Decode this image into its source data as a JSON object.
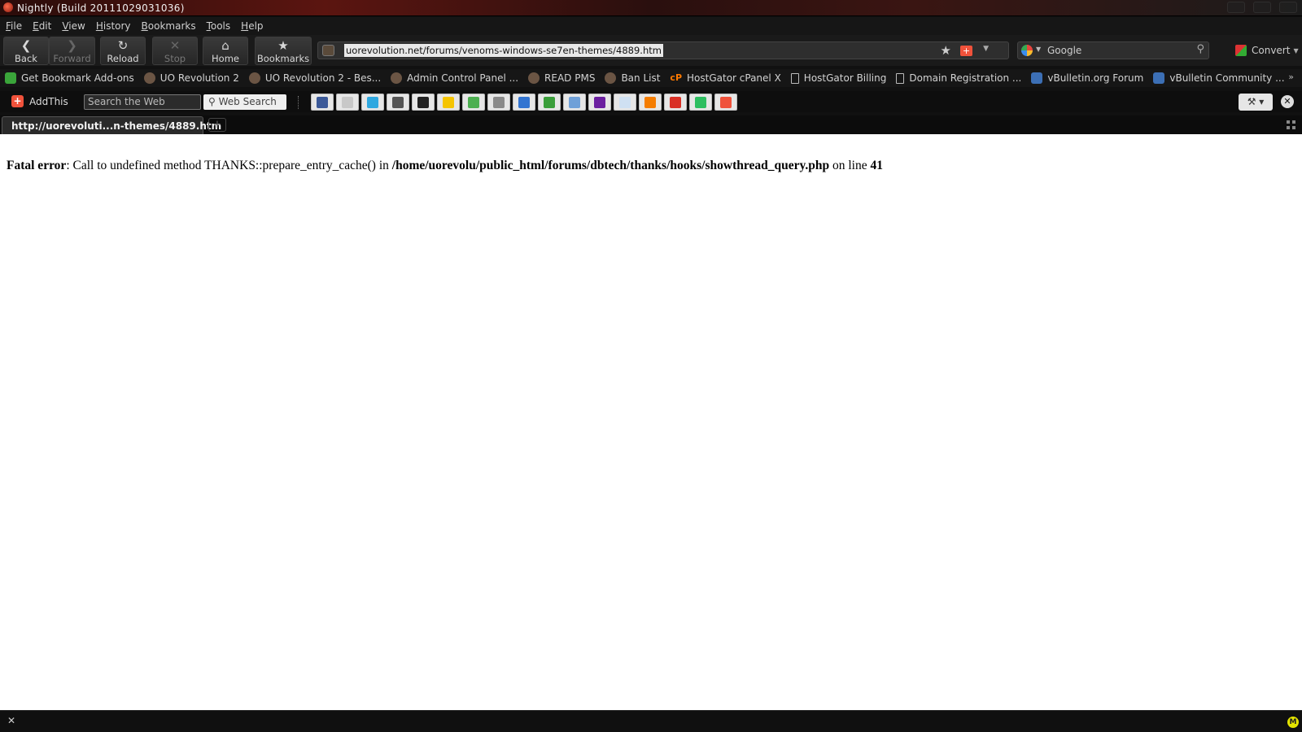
{
  "window": {
    "title": "Nightly (Build 20111029031036)"
  },
  "menu": {
    "items": [
      "File",
      "Edit",
      "View",
      "History",
      "Bookmarks",
      "Tools",
      "Help"
    ]
  },
  "nav": {
    "back": "Back",
    "forward": "Forward",
    "reload": "Reload",
    "stop": "Stop",
    "home": "Home",
    "bookmarks": "Bookmarks"
  },
  "urlbar": {
    "url": "uorevolution.net/forums/venoms-windows-se7en-themes/4889.htm"
  },
  "search": {
    "engine": "Google"
  },
  "convert": {
    "label": "Convert"
  },
  "bookmarks_bar": {
    "items": [
      {
        "label": "Get Bookmark Add-ons",
        "icon": "puzzle-icon"
      },
      {
        "label": "UO Revolution 2",
        "icon": "uo-favicon"
      },
      {
        "label": "UO Revolution 2 - Bes...",
        "icon": "uo-favicon"
      },
      {
        "label": "Admin Control Panel ...",
        "icon": "uo-favicon"
      },
      {
        "label": "READ PMS",
        "icon": "uo-favicon"
      },
      {
        "label": "Ban List",
        "icon": "uo-favicon"
      },
      {
        "label": "HostGator cPanel X",
        "icon": "cpanel-icon"
      },
      {
        "label": "HostGator Billing",
        "icon": "page-icon"
      },
      {
        "label": "Domain Registration ...",
        "icon": "page-icon"
      },
      {
        "label": "vBulletin.org Forum",
        "icon": "vbulletin-icon"
      },
      {
        "label": "vBulletin Community ...",
        "icon": "vbulletin-icon"
      }
    ]
  },
  "addthis": {
    "brand": "AddThis",
    "search_placeholder": "Search the Web",
    "search_button": "Web Search",
    "services": [
      {
        "name": "facebook-icon",
        "color": "#3b5998"
      },
      {
        "name": "email-icon",
        "color": "#c8c8c8"
      },
      {
        "name": "twitter-icon",
        "color": "#2fa8e0"
      },
      {
        "name": "print-icon",
        "color": "#555555"
      },
      {
        "name": "myspace-icon",
        "color": "#222222"
      },
      {
        "name": "favorites-icon",
        "color": "#f5c400"
      },
      {
        "name": "google-icon",
        "color": "#4caf50"
      },
      {
        "name": "digg-icon",
        "color": "#8a8a8a"
      },
      {
        "name": "delicious-icon",
        "color": "#3274d1"
      },
      {
        "name": "stumbleupon-icon",
        "color": "#3a9e3a"
      },
      {
        "name": "friendfeed-icon",
        "color": "#6fa0d8"
      },
      {
        "name": "yahoo-icon",
        "color": "#6b1fa0"
      },
      {
        "name": "reddit-icon",
        "color": "#cfe0f2"
      },
      {
        "name": "blogger-icon",
        "color": "#f57d00"
      },
      {
        "name": "gmail-icon",
        "color": "#d93025"
      },
      {
        "name": "evernote-icon",
        "color": "#2dbe60"
      },
      {
        "name": "more-icon",
        "color": "#f0523b"
      }
    ]
  },
  "tab": {
    "title": "http://uorevoluti...n-themes/4889.htm"
  },
  "page": {
    "error_label": "Fatal error",
    "error_message": ": Call to undefined method THANKS::prepare_entry_cache() in ",
    "error_path": "/home/uorevolu/public_html/forums/dbtech/thanks/hooks/showthread_query.php",
    "error_line_text": " on line ",
    "error_line": "41"
  }
}
